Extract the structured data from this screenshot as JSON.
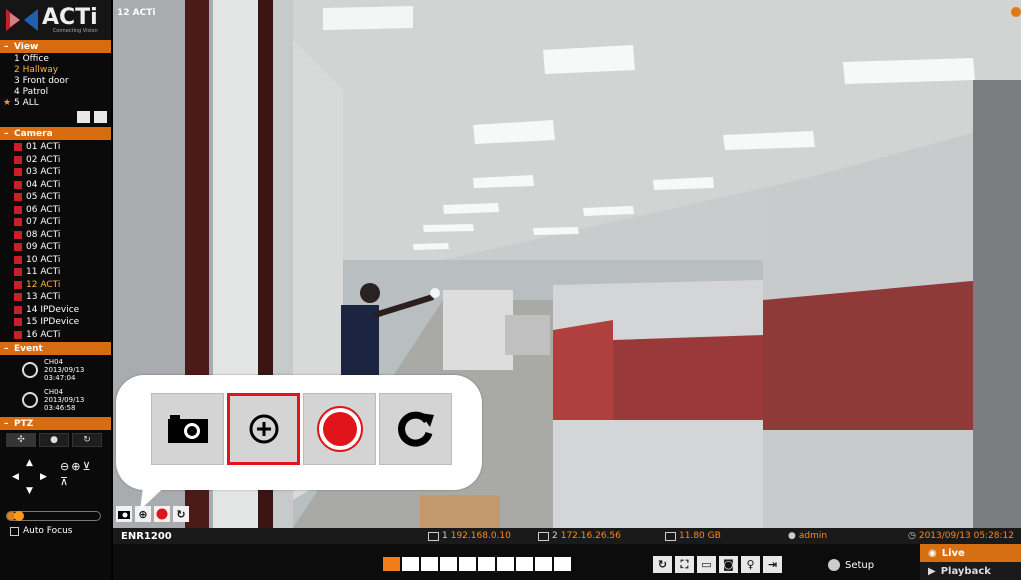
{
  "brand": {
    "name": "ACTi",
    "tagline": "Connecting Vision"
  },
  "sidebar": {
    "view": {
      "header": "View",
      "items": [
        "1 Office",
        "2 Hallway",
        "3 Front door",
        "4 Patrol",
        "5 ALL"
      ],
      "active_index": 1,
      "pinned_index": 4
    },
    "camera": {
      "header": "Camera",
      "items": [
        "01 ACTi",
        "02 ACTi",
        "03 ACTi",
        "04 ACTi",
        "05 ACTi",
        "06 ACTi",
        "07 ACTi",
        "08 ACTi",
        "09 ACTi",
        "10 ACTi",
        "11 ACTi",
        "12 ACTi",
        "13 ACTi",
        "14 IPDevice",
        "15 IPDevice",
        "16 ACTi"
      ],
      "active_index": 11
    },
    "event": {
      "header": "Event",
      "items": [
        {
          "channel": "CH04",
          "date": "2013/09/13",
          "time": "03:47:04"
        },
        {
          "channel": "CH04",
          "date": "2013/09/13",
          "time": "03:46:58"
        }
      ]
    },
    "ptz": {
      "header": "PTZ"
    },
    "focus_slider": {
      "value_fraction": 0.1
    },
    "auto_focus": {
      "label": "Auto Focus",
      "checked": false
    }
  },
  "video": {
    "channel_label": "12 ACTi"
  },
  "callout": {
    "buttons": [
      "snapshot-icon",
      "zoom-in-icon",
      "record-icon",
      "refresh-icon"
    ],
    "selected_index": 1,
    "accent_color": "#e0141a"
  },
  "status_bar": {
    "device_name": "ENR1200",
    "ip1_count": "1",
    "ip1": "192.168.0.10",
    "ip2_count": "2",
    "ip2": "172.16.26.56",
    "storage": "11.80 GB",
    "user": "admin",
    "datetime": "2013/09/13 05:28:12"
  },
  "bottom_bar": {
    "setup_label": "Setup",
    "live_label": "Live",
    "playback_label": "Playback",
    "accent_color": "#d66f12"
  }
}
